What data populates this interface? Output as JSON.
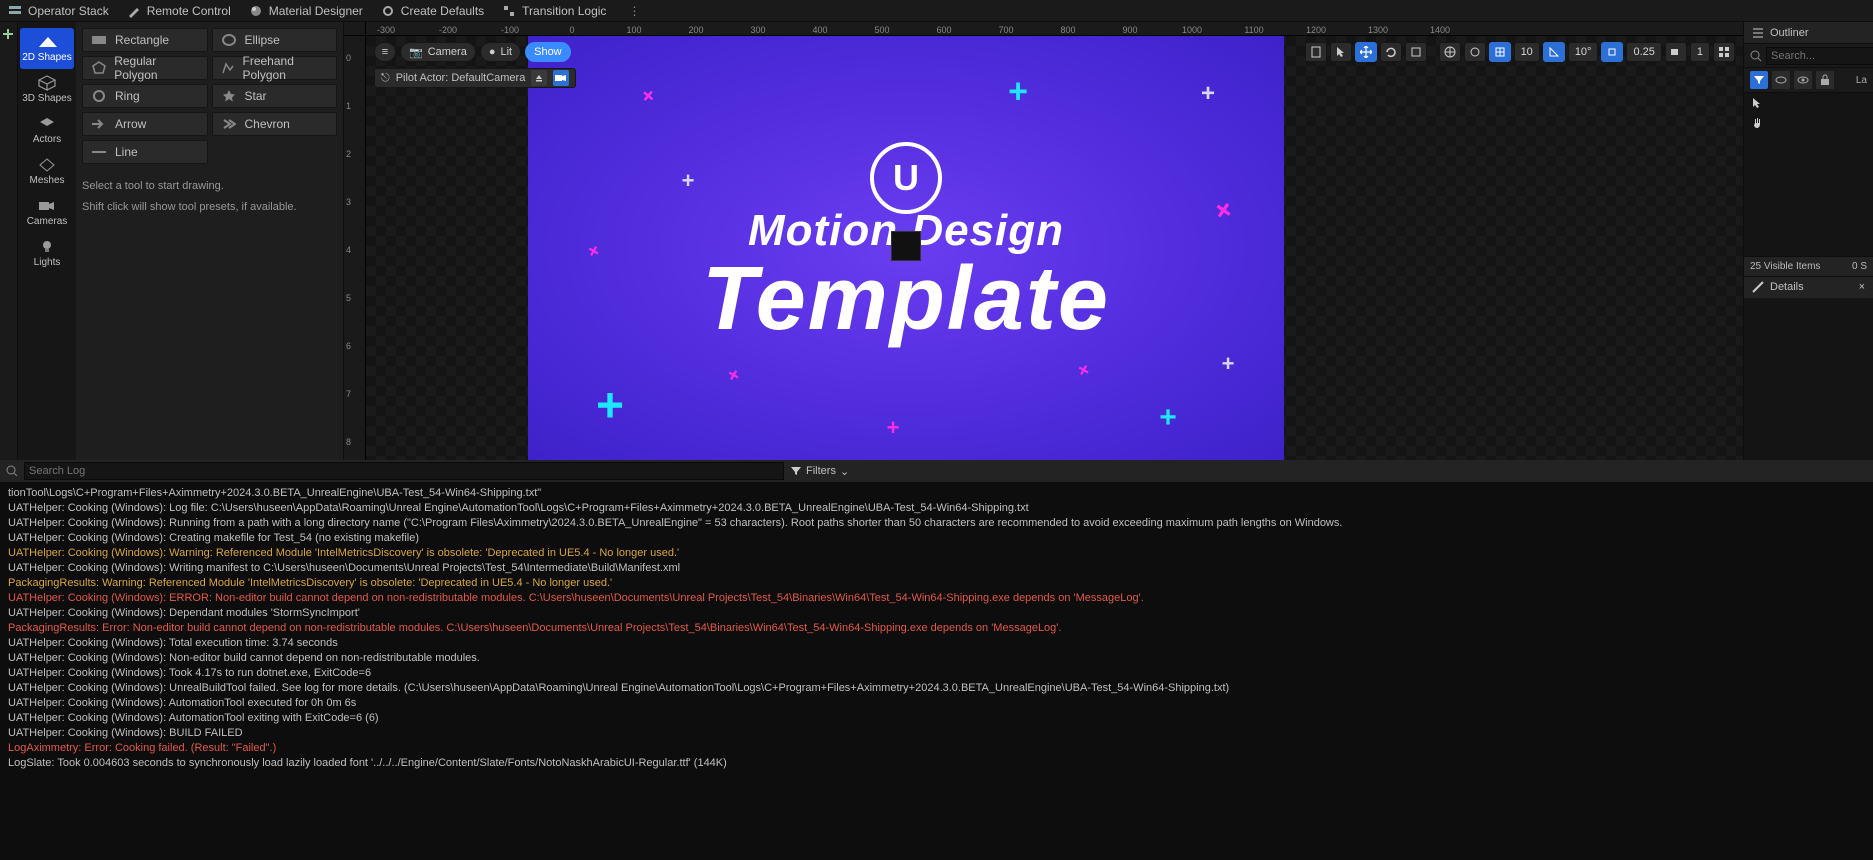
{
  "top_menu": {
    "items": [
      {
        "label": "Operator Stack"
      },
      {
        "label": "Remote Control"
      },
      {
        "label": "Material Designer"
      },
      {
        "label": "Create Defaults"
      },
      {
        "label": "Transition Logic"
      }
    ]
  },
  "modes": [
    {
      "label": "2D Shapes",
      "active": true
    },
    {
      "label": "3D Shapes"
    },
    {
      "label": "Actors"
    },
    {
      "label": "Meshes"
    },
    {
      "label": "Cameras"
    },
    {
      "label": "Lights"
    }
  ],
  "shapes": [
    {
      "label": "Rectangle"
    },
    {
      "label": "Ellipse"
    },
    {
      "label": "Regular Polygon"
    },
    {
      "label": "Freehand Polygon"
    },
    {
      "label": "Ring"
    },
    {
      "label": "Star"
    },
    {
      "label": "Arrow"
    },
    {
      "label": "Chevron"
    },
    {
      "label": "Line"
    }
  ],
  "shape_hint1": "Select a tool to start drawing.",
  "shape_hint2": "Shift click will show tool presets, if available.",
  "ruler_h": [
    "-300",
    "-200",
    "-100",
    "0",
    "100",
    "200",
    "300",
    "400",
    "500",
    "600",
    "700",
    "800",
    "900",
    "1000",
    "1100",
    "1200",
    "1300",
    "1400"
  ],
  "ruler_v": [
    "0",
    "1",
    "2",
    "3",
    "4",
    "5",
    "6",
    "7",
    "8"
  ],
  "vp": {
    "camera": "Camera",
    "lit": "Lit",
    "show": "Show",
    "pilot": "Pilot Actor: DefaultCamera",
    "vals": {
      "grid": "10",
      "angle": "10°",
      "scale": "0.25",
      "cam": "1"
    }
  },
  "canvas": {
    "logo": "U",
    "title1": "Motion Design",
    "title2": "Template"
  },
  "outliner": {
    "tab": "Outliner",
    "search_ph": "Search...",
    "visible": "Visible Items",
    "count": "25",
    "sel": "0",
    "la": "La",
    "details": "Details"
  },
  "log": {
    "search_ph": "Search Log",
    "filters": "Filters",
    "lines": [
      {
        "c": "n",
        "t": "tionTool\\Logs\\C+Program+Files+Aximmetry+2024.3.0.BETA_UnrealEngine\\UBA-Test_54-Win64-Shipping.txt\""
      },
      {
        "c": "n",
        "t": "UATHelper: Cooking (Windows): Log file: C:\\Users\\huseen\\AppData\\Roaming\\Unreal Engine\\AutomationTool\\Logs\\C+Program+Files+Aximmetry+2024.3.0.BETA_UnrealEngine\\UBA-Test_54-Win64-Shipping.txt"
      },
      {
        "c": "n",
        "t": "UATHelper: Cooking (Windows): Running from a path with a long directory name (\"C:\\Program Files\\Aximmetry\\2024.3.0.BETA_UnrealEngine\" = 53 characters). Root paths shorter than 50 characters are recommended to avoid exceeding maximum path lengths on Windows."
      },
      {
        "c": "n",
        "t": "UATHelper: Cooking (Windows): Creating makefile for Test_54 (no existing makefile)"
      },
      {
        "c": "w",
        "t": "UATHelper: Cooking (Windows): Warning: Referenced Module 'IntelMetricsDiscovery' is obsolete: 'Deprecated in UE5.4 - No longer used.'"
      },
      {
        "c": "n",
        "t": "UATHelper: Cooking (Windows): Writing manifest to C:\\Users\\huseen\\Documents\\Unreal Projects\\Test_54\\Intermediate\\Build\\Manifest.xml"
      },
      {
        "c": "w",
        "t": "PackagingResults: Warning: Referenced Module 'IntelMetricsDiscovery' is obsolete: 'Deprecated in UE5.4 - No longer used.'"
      },
      {
        "c": "e",
        "t": "UATHelper: Cooking (Windows): ERROR: Non-editor build cannot depend on non-redistributable modules. C:\\Users\\huseen\\Documents\\Unreal Projects\\Test_54\\Binaries\\Win64\\Test_54-Win64-Shipping.exe depends on 'MessageLog'."
      },
      {
        "c": "n",
        "t": "UATHelper: Cooking (Windows): Dependant modules 'StormSyncImport'"
      },
      {
        "c": "e",
        "t": "PackagingResults: Error: Non-editor build cannot depend on non-redistributable modules. C:\\Users\\huseen\\Documents\\Unreal Projects\\Test_54\\Binaries\\Win64\\Test_54-Win64-Shipping.exe depends on 'MessageLog'."
      },
      {
        "c": "n",
        "t": "UATHelper: Cooking (Windows): Total execution time: 3.74 seconds"
      },
      {
        "c": "n",
        "t": "UATHelper: Cooking (Windows): Non-editor build cannot depend on non-redistributable modules."
      },
      {
        "c": "n",
        "t": "UATHelper: Cooking (Windows): Took 4.17s to run dotnet.exe, ExitCode=6"
      },
      {
        "c": "n",
        "t": "UATHelper: Cooking (Windows): UnrealBuildTool failed. See log for more details. (C:\\Users\\huseen\\AppData\\Roaming\\Unreal Engine\\AutomationTool\\Logs\\C+Program+Files+Aximmetry+2024.3.0.BETA_UnrealEngine\\UBA-Test_54-Win64-Shipping.txt)"
      },
      {
        "c": "n",
        "t": "UATHelper: Cooking (Windows): AutomationTool executed for 0h 0m 6s"
      },
      {
        "c": "n",
        "t": "UATHelper: Cooking (Windows): AutomationTool exiting with ExitCode=6 (6)"
      },
      {
        "c": "n",
        "t": "UATHelper: Cooking (Windows): BUILD FAILED"
      },
      {
        "c": "e",
        "t": "LogAximmetry: Error: Cooking failed. (Result: \"Failed\".)"
      },
      {
        "c": "n",
        "t": "LogSlate: Took 0.004603 seconds to synchronously load lazily loaded font '../../../Engine/Content/Slate/Fonts/NotoNaskhArabicUI-Regular.ttf' (144K)"
      }
    ]
  }
}
